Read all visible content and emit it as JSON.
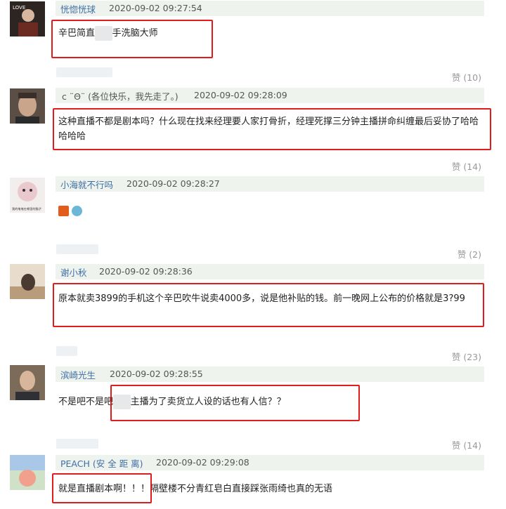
{
  "comments": [
    {
      "user": "恍惚恍球",
      "time": "2020-09-02 09:27:54",
      "text_a": "辛巴简直",
      "text_mask": "■■",
      "text_b": "手洗脑大师",
      "likes": "赞 (10)"
    },
    {
      "user": "c ¨Θ¨ (各位快乐，我先走了。)",
      "time": "2020-09-02 09:28:09",
      "text": "这种直播不都是剧本吗？什么现在找来经理要人家打骨折，经理死撑三分钟主播拼命纠缠最后妥协了哈哈哈哈哈",
      "likes": "赞 (14)"
    },
    {
      "user": "小海就不行吗",
      "time": "2020-09-02 09:28:27",
      "avatar_caption": "我的笔笔在哪里的猫子",
      "likes": "赞 (2)"
    },
    {
      "user": "谢小秋",
      "time": "2020-09-02 09:28:36",
      "text": "原本就卖3899的手机这个辛巴吹牛说卖4000多，说是他补贴的钱。前一晚网上公布的价格就是3?99",
      "likes": "赞 (23)"
    },
    {
      "user": "滨崎光生",
      "time": "2020-09-02 09:28:55",
      "text_a": "不是吧不是吧",
      "text_mask": "■■",
      "text_b": "主播为了卖货立人设的话也有人信？？",
      "likes": "赞 (14)"
    },
    {
      "user": "PEACH (安 全 距 离)",
      "time": "2020-09-02 09:29:08",
      "text_a": "就是直播剧本啊！！！",
      "text_b": "隔壁楼不分青红皂白直接踩张雨绮也真的无语"
    }
  ],
  "colors": {
    "highlight": "#e21b1b",
    "username": "#3f6ea6",
    "meta_bg": "#eef3ee"
  }
}
